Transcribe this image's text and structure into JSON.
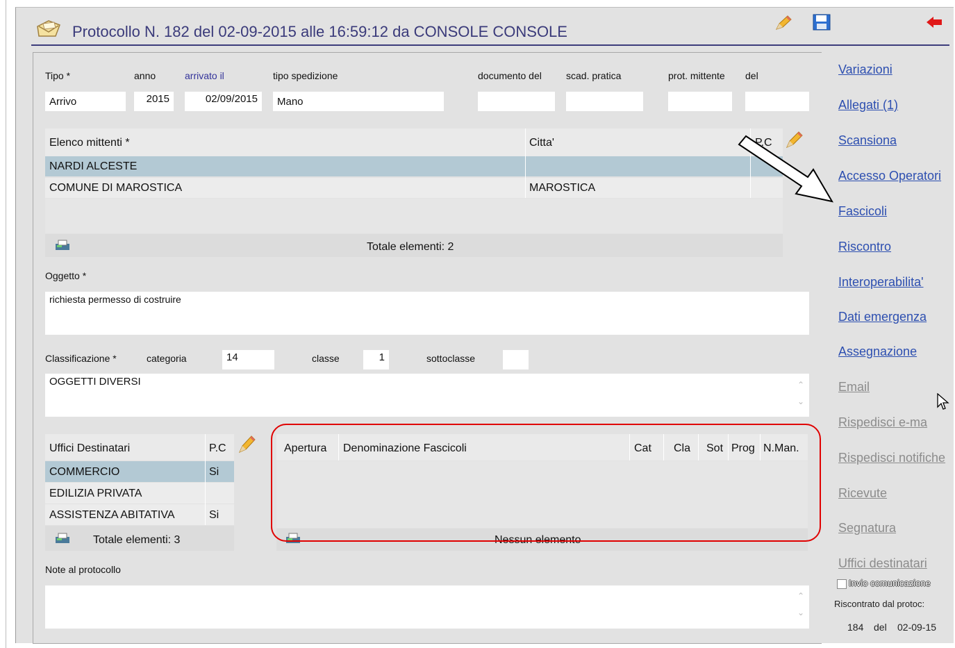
{
  "header": {
    "title": "Protocollo N.  182  del  02-09-2015  alle  16:59:12  da  CONSOLE CONSOLE"
  },
  "fields": {
    "tipo_label": "Tipo *",
    "tipo_value": "Arrivo",
    "anno_label": "anno",
    "anno_value": "2015",
    "arrivato_label": "arrivato il",
    "arrivato_value": "02/09/2015",
    "spedizione_label": "tipo spedizione",
    "spedizione_value": "Mano",
    "documento_label": "documento del",
    "documento_value": "",
    "scad_label": "scad. pratica",
    "scad_value": "",
    "prot_label": "prot. mittente",
    "prot_value": "",
    "del_label": "del",
    "del_value": ""
  },
  "mittenti": {
    "headers": [
      "Elenco mittenti *",
      "Citta'",
      "P.C"
    ],
    "rows": [
      {
        "nome": "NARDI ALCESTE",
        "citta": "",
        "pc": ""
      },
      {
        "nome": "COMUNE DI MAROSTICA",
        "citta": "MAROSTICA",
        "pc": ""
      }
    ],
    "totale": "Totale elementi: 2"
  },
  "oggetto": {
    "label": "Oggetto *",
    "value": "richiesta permesso di costruire"
  },
  "classificazione": {
    "label": "Classificazione *",
    "categoria_label": "categoria",
    "categoria_value": "14",
    "classe_label": "classe",
    "classe_value": "1",
    "sottoclasse_label": "sottoclasse",
    "sottoclasse_value": "",
    "descrizione": "OGGETTI DIVERSI"
  },
  "uffici": {
    "headers": [
      "Uffici Destinatari",
      "P.C"
    ],
    "rows": [
      {
        "nome": "COMMERCIO",
        "pc": "Si"
      },
      {
        "nome": "EDILIZIA PRIVATA",
        "pc": ""
      },
      {
        "nome": "ASSISTENZA ABITATIVA",
        "pc": "Si"
      }
    ],
    "totale": "Totale elementi: 3"
  },
  "fascicoli": {
    "headers": [
      "Apertura",
      "Denominazione Fascicoli",
      "Cat",
      "Cla",
      "Sot",
      "Prog",
      "N.Man."
    ],
    "empty": "Nessun elemento"
  },
  "note": {
    "label": "Note al protocollo",
    "value": ""
  },
  "sidebar": {
    "links": [
      {
        "label": "Variazioni",
        "active": true
      },
      {
        "label": "Allegati (1)",
        "active": true
      },
      {
        "label": "Scansiona",
        "active": true
      },
      {
        "label": "Accesso Operatori",
        "active": true
      },
      {
        "label": "Fascicoli",
        "active": true
      },
      {
        "label": "Riscontro",
        "active": true
      },
      {
        "label": "Interoperabilita'",
        "active": true
      },
      {
        "label": "Dati emergenza",
        "active": true
      },
      {
        "label": "Assegnazione",
        "active": true
      },
      {
        "label": "Email",
        "active": false
      },
      {
        "label": "Rispedisci e-ma",
        "active": false
      },
      {
        "label": "Rispedisci notifiche",
        "active": false
      },
      {
        "label": "Ricevute",
        "active": false
      },
      {
        "label": "Segnatura",
        "active": false
      },
      {
        "label": "Uffici destinatari",
        "active": false
      }
    ],
    "invio_label": "Invio comunicazione",
    "riscontro_label": "Riscontrato dal protoc:",
    "riscontro_num": "184",
    "riscontro_del": "del",
    "riscontro_data": "02-09-15"
  },
  "colors": {
    "link_active": "#2d4fb0",
    "link_disabled": "#8c8c8c",
    "selected_row": "#b3c9d4",
    "highlight": "#e00000",
    "title": "#3a3a7a"
  }
}
